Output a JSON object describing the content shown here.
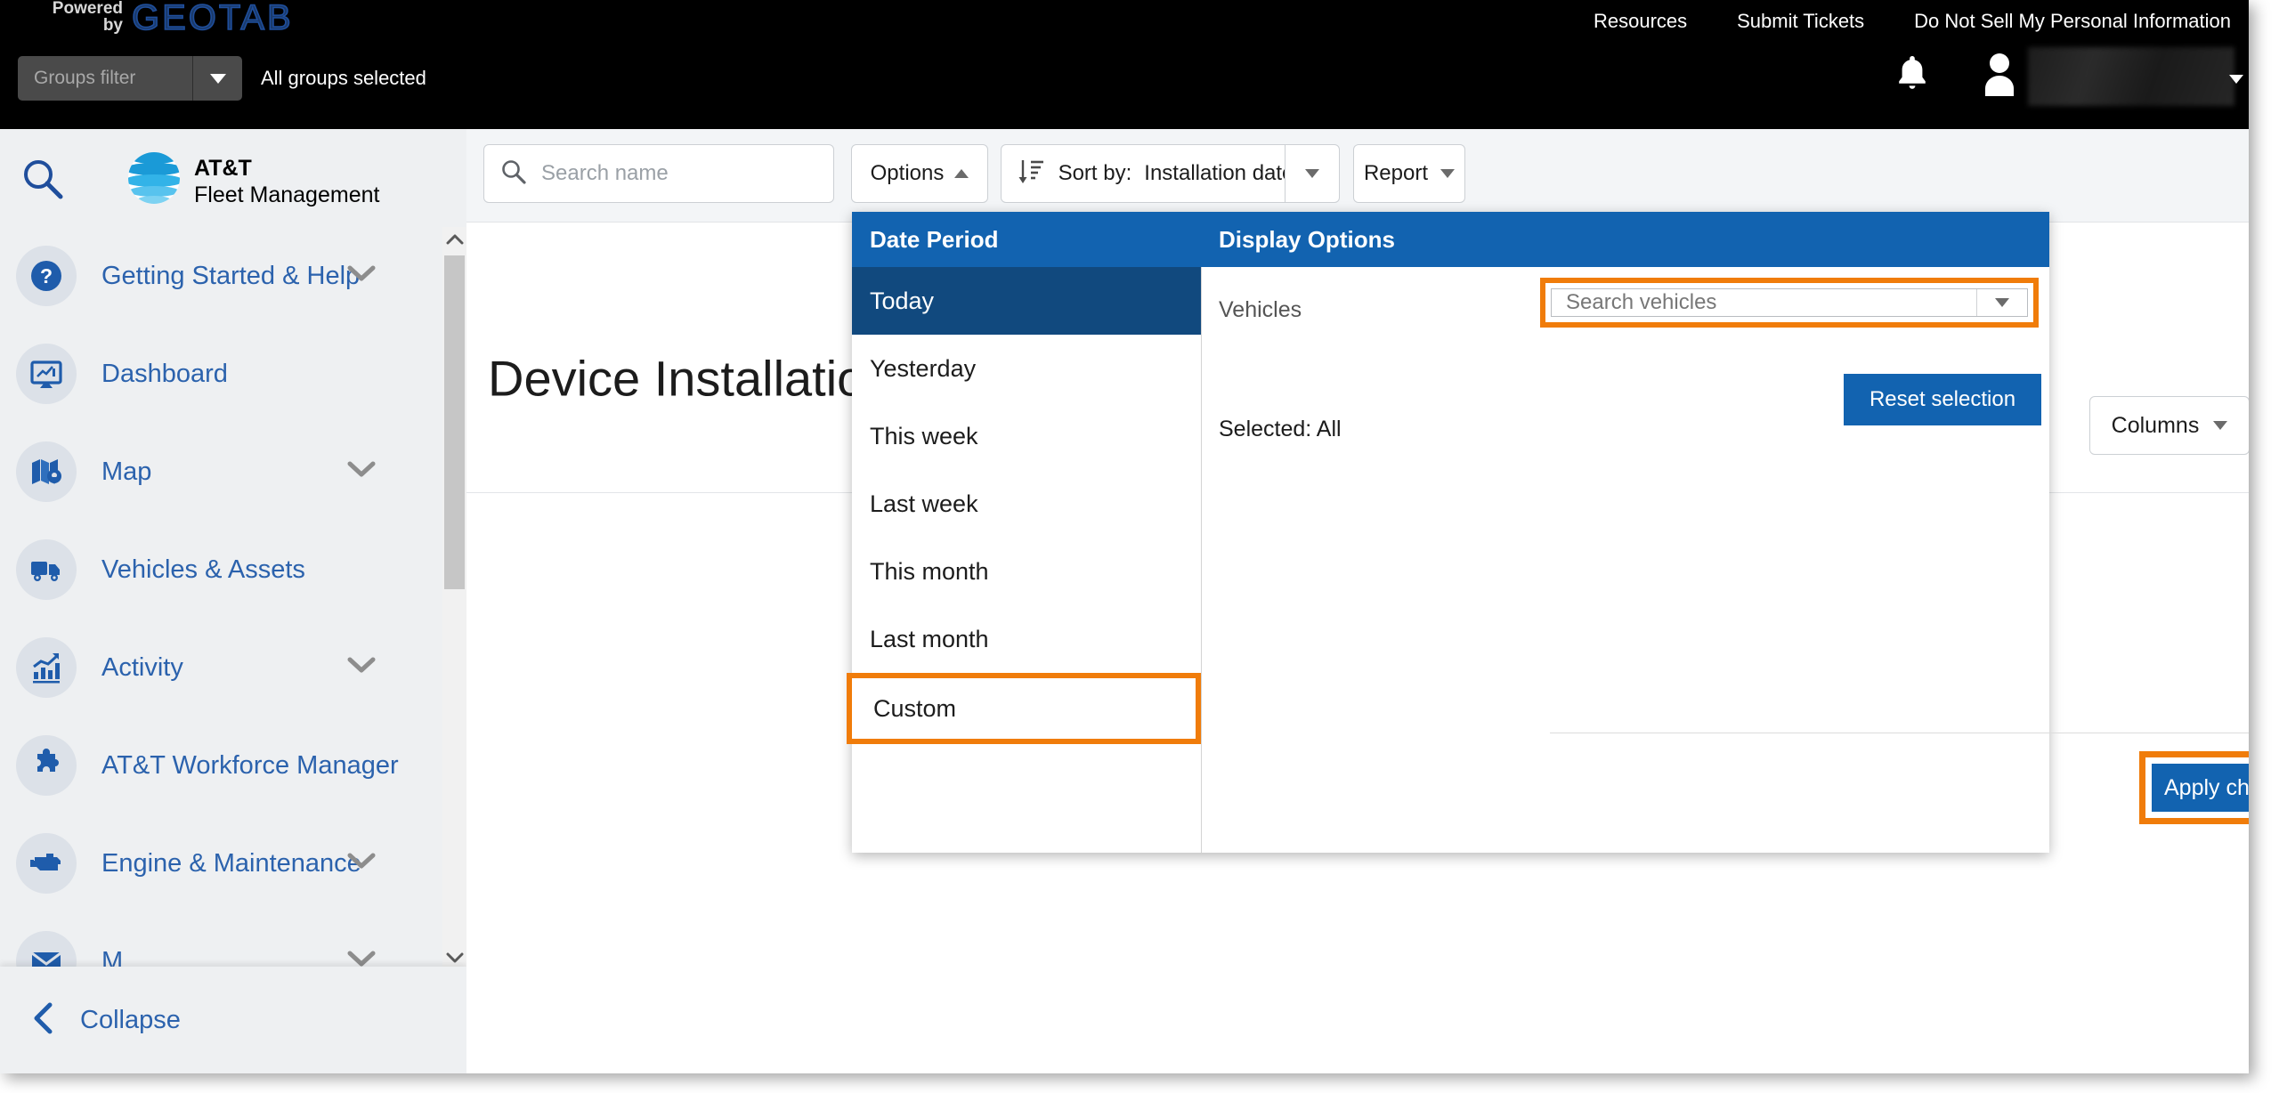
{
  "topbar": {
    "powered_line1": "Powered",
    "powered_line2": "by",
    "brand": "GEOTAB",
    "nav": [
      {
        "label": "Resources"
      },
      {
        "label": "Submit Tickets"
      },
      {
        "label": "Do Not Sell My Personal Information"
      }
    ],
    "groups_filter_placeholder": "Groups filter",
    "groups_status": "All groups selected",
    "bell_icon": "notification-bell-icon",
    "user_icon": "user-avatar-icon",
    "user_name": ""
  },
  "sidebar": {
    "search_icon": "search-icon",
    "logo_line1": "AT&T",
    "logo_line2": "Fleet Management",
    "items": [
      {
        "label": "Getting Started & Help",
        "icon": "question-mark-icon",
        "chevron": true
      },
      {
        "label": "Dashboard",
        "icon": "monitor-chart-icon",
        "chevron": false
      },
      {
        "label": "Map",
        "icon": "map-pin-icon",
        "chevron": true
      },
      {
        "label": "Vehicles & Assets",
        "icon": "truck-icon",
        "chevron": false
      },
      {
        "label": "Activity",
        "icon": "bar-chart-trend-icon",
        "chevron": true
      },
      {
        "label": "AT&T Workforce Manager",
        "icon": "puzzle-piece-icon",
        "chevron": false
      },
      {
        "label": "Engine & Maintenance",
        "icon": "engine-icon",
        "chevron": true
      },
      {
        "label": "M",
        "icon": "envelope-icon",
        "chevron": true
      }
    ],
    "collapse_label": "Collapse",
    "collapse_icon": "chevron-left-icon"
  },
  "toolbar": {
    "search_placeholder": "Search name",
    "search_icon": "search-icon",
    "options_label": "Options",
    "sort_icon": "sort-descending-icon",
    "sort_label": "Sort by:",
    "sort_value": "Installation date",
    "report_label": "Report",
    "columns_label": "Columns"
  },
  "page": {
    "title": "Device Installation"
  },
  "panel": {
    "date_period": {
      "header": "Date Period",
      "items": [
        {
          "label": "Today",
          "state": "selected"
        },
        {
          "label": "Yesterday",
          "state": "normal"
        },
        {
          "label": "This week",
          "state": "normal"
        },
        {
          "label": "Last week",
          "state": "normal"
        },
        {
          "label": "This month",
          "state": "normal"
        },
        {
          "label": "Last month",
          "state": "normal"
        },
        {
          "label": "Custom",
          "state": "highlighted"
        }
      ]
    },
    "display_options": {
      "header": "Display Options",
      "vehicles_label": "Vehicles",
      "vehicles_placeholder": "Search vehicles",
      "reset_label": "Reset selection",
      "selected_text": "Selected: All",
      "apply_label": "Apply changes"
    }
  },
  "colors": {
    "panel_header_blue": "#1263b0",
    "selected_row_blue": "#11497e",
    "highlight_orange": "#f07c0a",
    "link_blue": "#2b62ad",
    "topbar_black": "#000000"
  }
}
